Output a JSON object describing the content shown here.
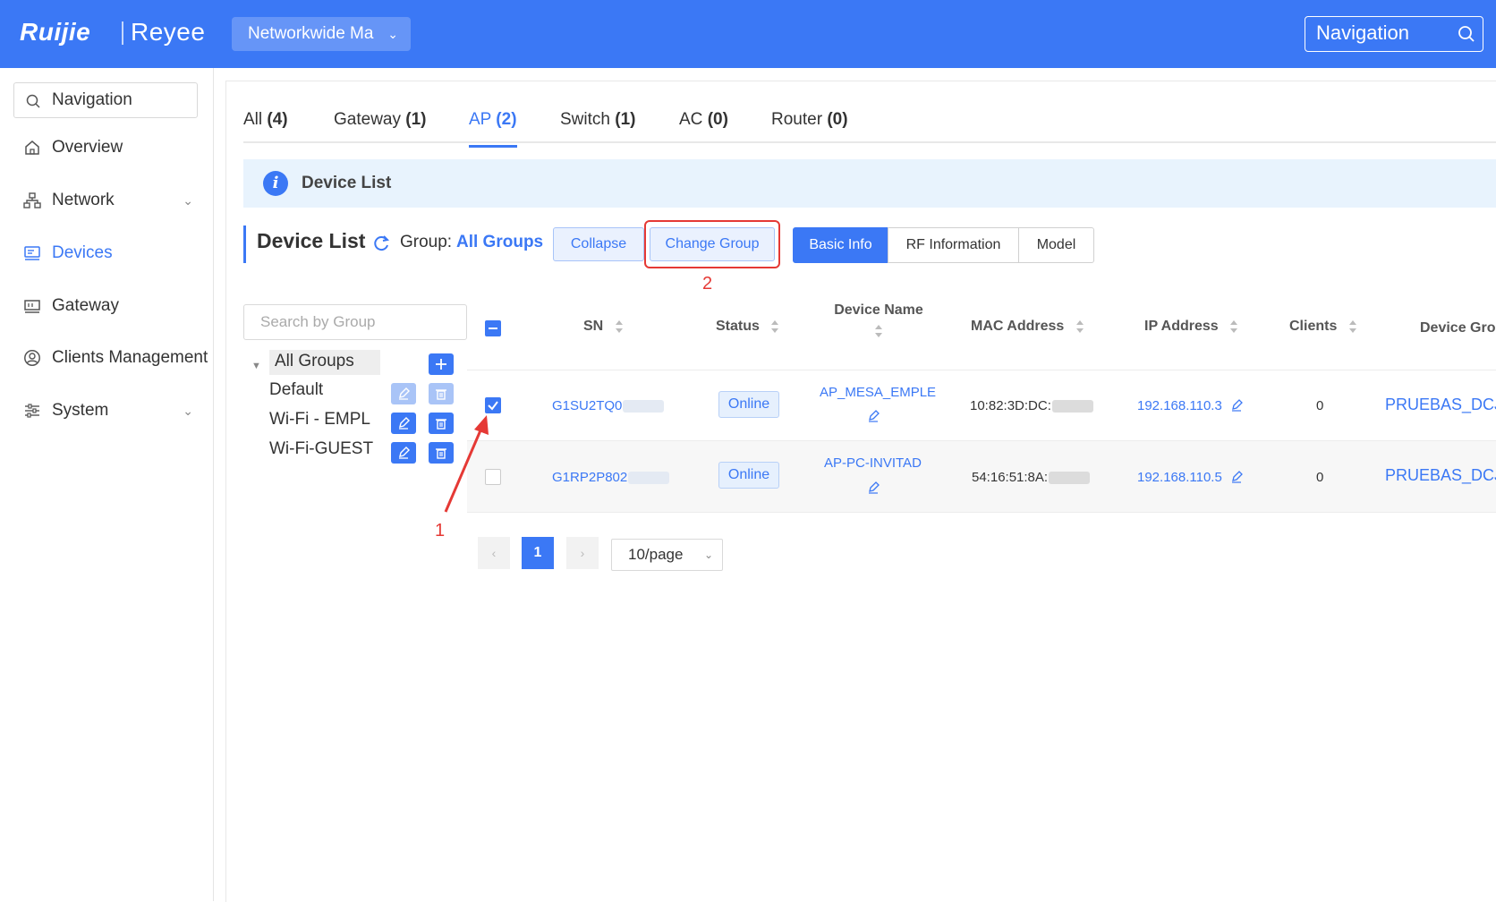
{
  "header": {
    "logo_text": "Ruijie",
    "logo_subtext": "Reyee",
    "network_selector": "Networkwide Ma",
    "nav_search": "Navigation"
  },
  "sidebar": {
    "search": "Navigation",
    "items": [
      {
        "label": "Overview",
        "icon": "home-icon"
      },
      {
        "label": "Network",
        "icon": "network-topology-icon"
      },
      {
        "label": "Devices",
        "icon": "devices-icon"
      },
      {
        "label": "Gateway",
        "icon": "gateway-icon"
      },
      {
        "label": "Clients Management",
        "icon": "user-circle-icon"
      },
      {
        "label": "System",
        "icon": "settings-sliders-icon"
      }
    ]
  },
  "tabs": [
    {
      "name": "All",
      "count": "(4)"
    },
    {
      "name": "Gateway",
      "count": "(1)"
    },
    {
      "name": "AP",
      "count": "(2)"
    },
    {
      "name": "Switch",
      "count": "(1)"
    },
    {
      "name": "AC",
      "count": "(0)"
    },
    {
      "name": "Router",
      "count": "(0)"
    }
  ],
  "info_bar": {
    "text": "Device List"
  },
  "device_list": {
    "title": "Device List",
    "group_label": "Group:",
    "group_value": "All Groups",
    "collapse_label": "Collapse",
    "change_group_label": "Change Group",
    "view_tabs": [
      "Basic Info",
      "RF Information",
      "Model"
    ]
  },
  "annotations": {
    "one": "1",
    "two": "2"
  },
  "groups": {
    "search_placeholder": "Search by Group",
    "items": [
      "All Groups",
      "Default",
      "Wi-Fi - EMPL",
      "Wi-Fi-GUEST"
    ]
  },
  "table": {
    "headers": [
      "SN",
      "Status",
      "Device Name",
      "MAC Address",
      "IP Address",
      "Clients",
      "Device Grou"
    ],
    "rows": [
      {
        "sn": "G1SU2TQ0",
        "status": "Online",
        "name": "AP_MESA_EMPLE",
        "mac": "10:82:3D:DC:",
        "ip": "192.168.110.3",
        "clients": "0",
        "group": "PRUEBAS_DCJ"
      },
      {
        "sn": "G1RP2P802",
        "status": "Online",
        "name": "AP-PC-INVITAD",
        "mac": "54:16:51:8A:",
        "ip": "192.168.110.5",
        "clients": "0",
        "group": "PRUEBAS_DCJ"
      }
    ]
  },
  "pagination": {
    "current": "1",
    "page_size": "10/page"
  },
  "colors": {
    "accent": "#3b78f5",
    "annotation": "#e53935"
  }
}
